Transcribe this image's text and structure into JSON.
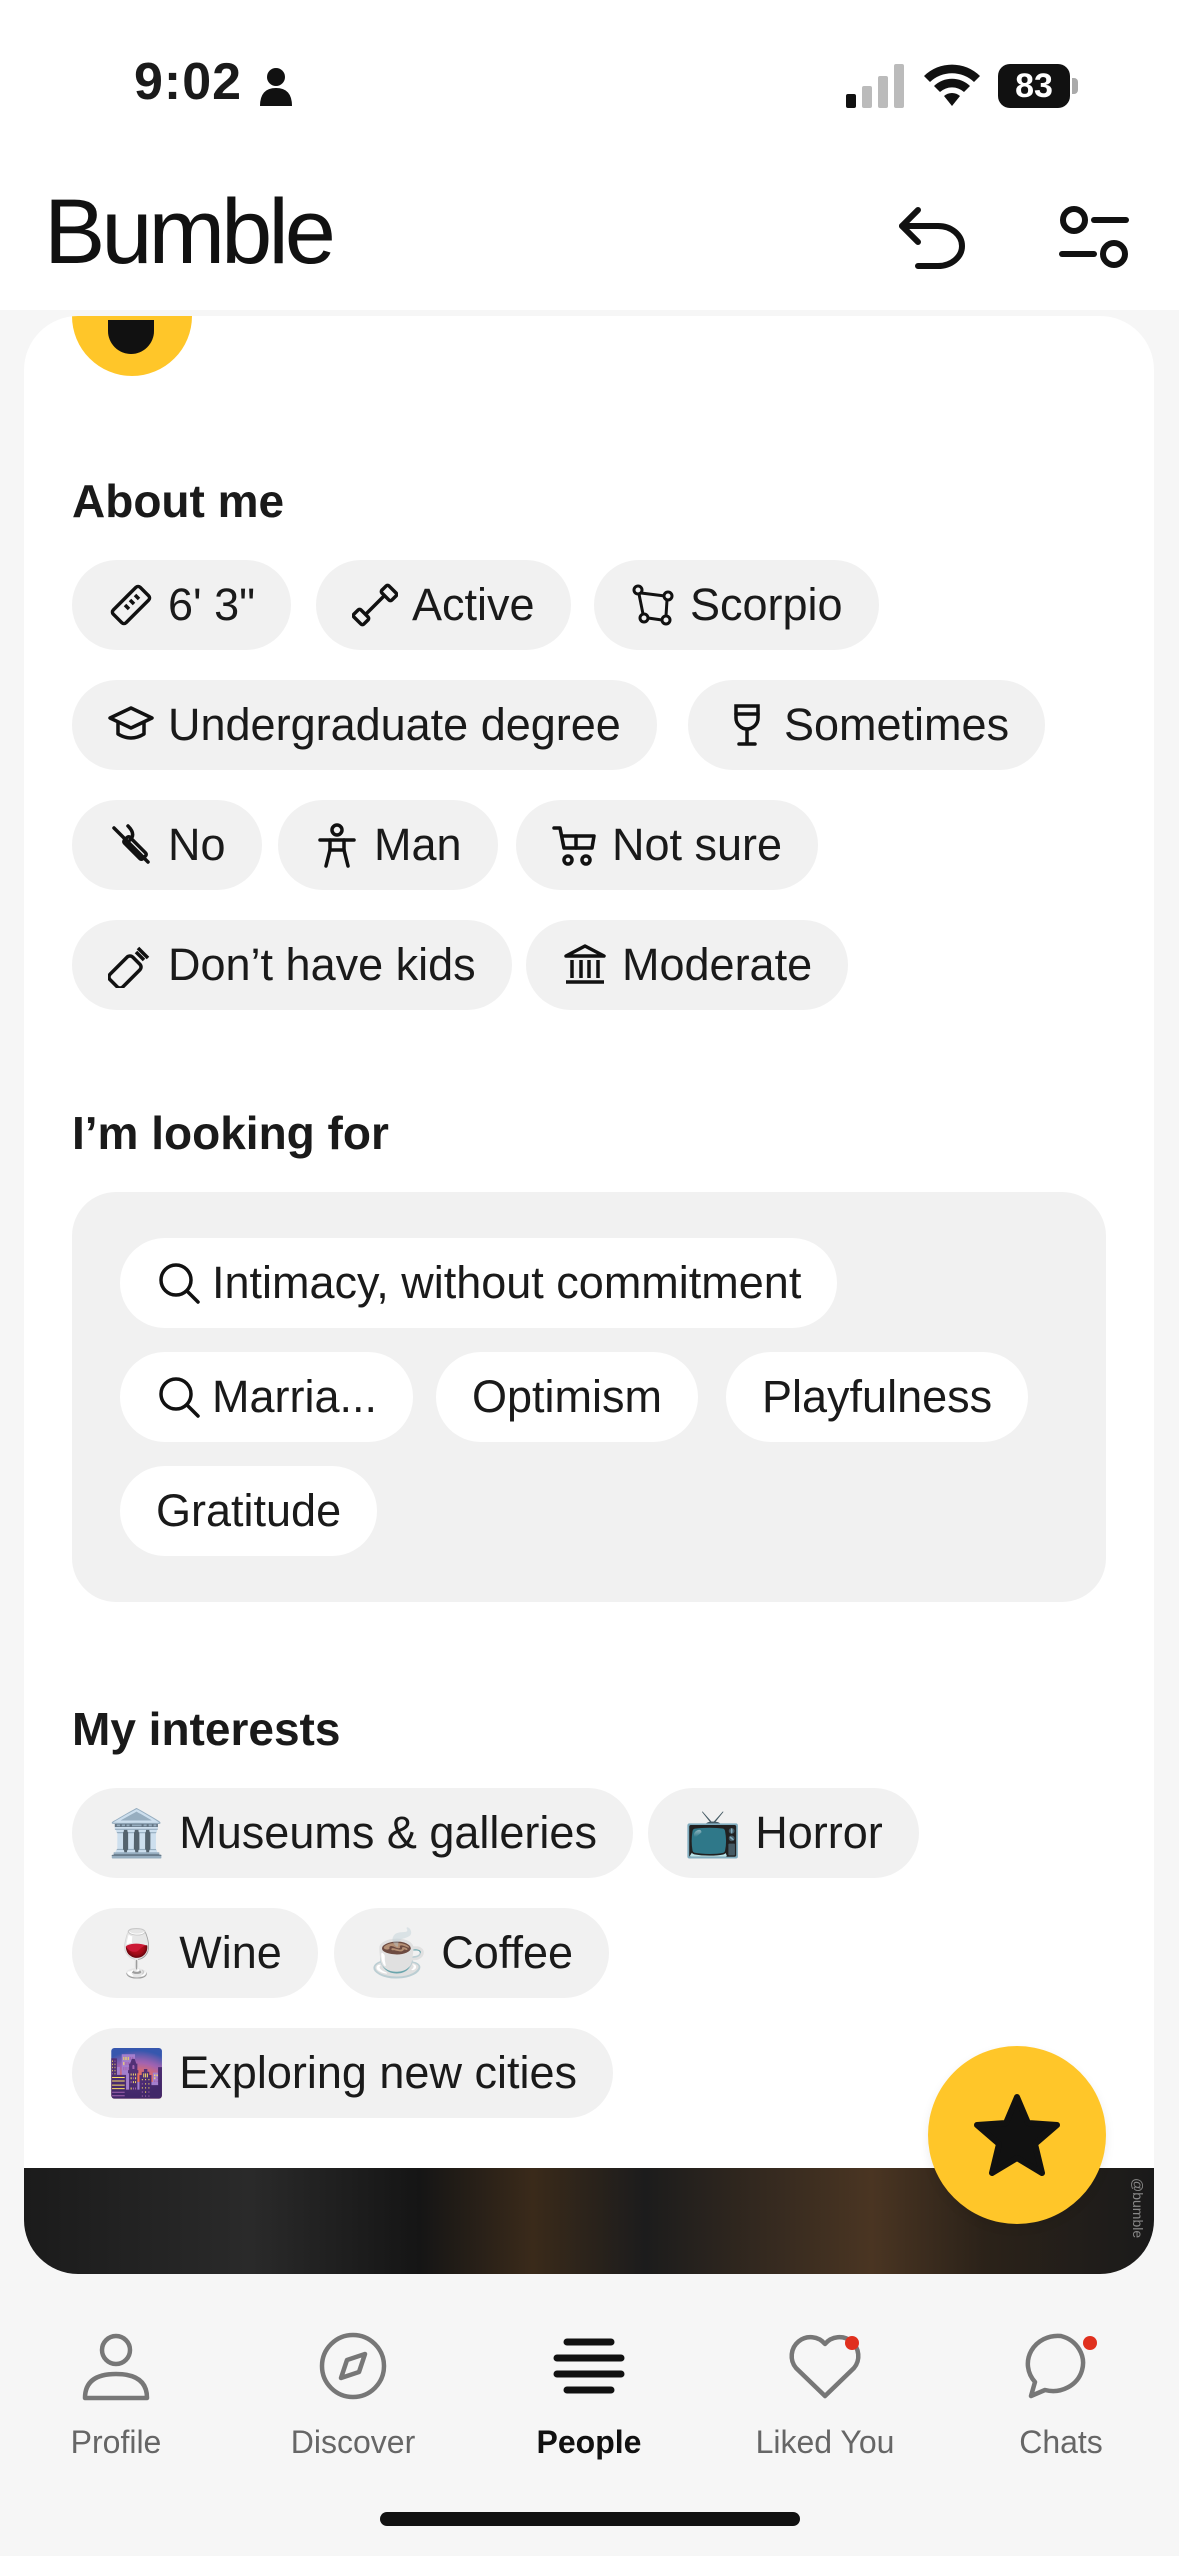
{
  "status": {
    "time": "9:02",
    "battery": "83"
  },
  "header": {
    "logo": "Bumble"
  },
  "about": {
    "title": "About me",
    "chips": [
      {
        "icon": "ruler-icon",
        "label": "6' 3\""
      },
      {
        "icon": "dumbbell-icon",
        "label": "Active"
      },
      {
        "icon": "zodiac-icon",
        "label": "Scorpio"
      },
      {
        "icon": "graduation-cap-icon",
        "label": "Undergraduate degree"
      },
      {
        "icon": "wine-glass-icon",
        "label": "Sometimes"
      },
      {
        "icon": "no-smoking-icon",
        "label": "No"
      },
      {
        "icon": "person-icon",
        "label": "Man"
      },
      {
        "icon": "stroller-icon",
        "label": "Not sure"
      },
      {
        "icon": "bottle-icon",
        "label": "Don’t have kids"
      },
      {
        "icon": "government-icon",
        "label": "Moderate"
      }
    ]
  },
  "looking": {
    "title": "I’m looking for",
    "chips": [
      {
        "icon": "search-icon",
        "label": "Intimacy, without commitment"
      },
      {
        "icon": "search-icon",
        "label": "Marria..."
      },
      {
        "icon": "",
        "label": "Optimism"
      },
      {
        "icon": "",
        "label": "Playfulness"
      },
      {
        "icon": "",
        "label": "Gratitude"
      }
    ]
  },
  "interests": {
    "title": "My interests",
    "chips": [
      {
        "emoji": "🏛️",
        "label": "Museums & galleries"
      },
      {
        "emoji": "📺",
        "label": "Horror"
      },
      {
        "emoji": "🍷",
        "label": "Wine"
      },
      {
        "emoji": "☕",
        "label": "Coffee"
      },
      {
        "emoji": "🌆",
        "label": "Exploring new cities"
      }
    ]
  },
  "photo": {
    "watermark": "@bumble"
  },
  "tabs": [
    {
      "label": "Profile",
      "icon": "profile-icon",
      "active": false,
      "badge": false
    },
    {
      "label": "Discover",
      "icon": "compass-icon",
      "active": false,
      "badge": false
    },
    {
      "label": "People",
      "icon": "people-icon",
      "active": true,
      "badge": false
    },
    {
      "label": "Liked You",
      "icon": "heart-icon",
      "active": false,
      "badge": true
    },
    {
      "label": "Chats",
      "icon": "chat-icon",
      "active": false,
      "badge": true
    }
  ],
  "colors": {
    "brand": "#ffc629",
    "chip_bg": "#f1f1f1",
    "notification": "#e0301e"
  }
}
